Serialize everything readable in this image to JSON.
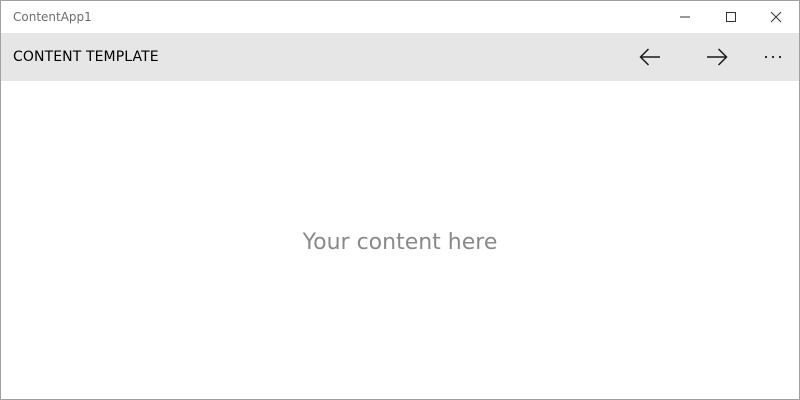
{
  "window": {
    "title": "ContentApp1"
  },
  "caption_buttons": {
    "minimize_icon": "minimize-icon",
    "maximize_icon": "maximize-icon",
    "close_icon": "close-icon"
  },
  "command_bar": {
    "title": "CONTENT TEMPLATE",
    "background": "#e6e6e6",
    "back_icon": "arrow-left-icon",
    "forward_icon": "arrow-right-icon",
    "more_icon": "ellipsis-icon"
  },
  "main": {
    "placeholder": "Your content here",
    "placeholder_color": "#8a8a8a"
  }
}
